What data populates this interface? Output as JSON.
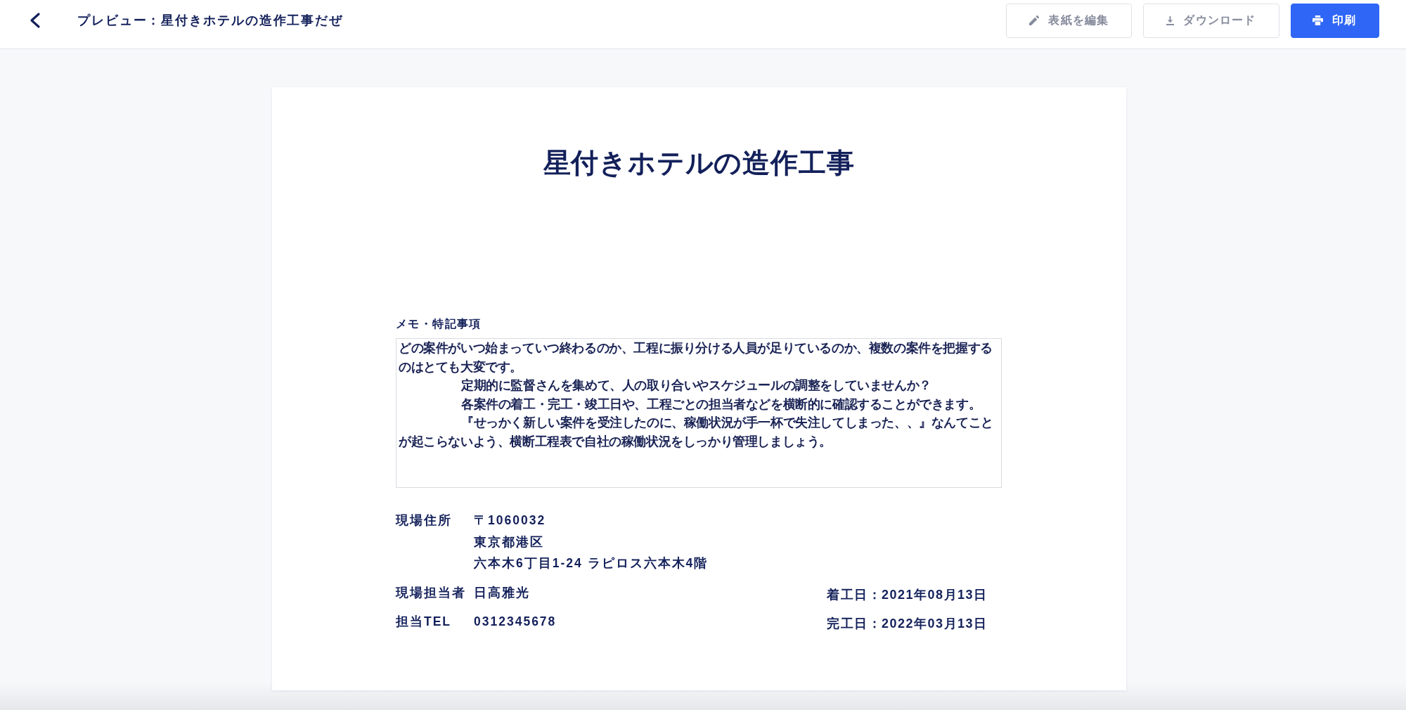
{
  "header": {
    "title": "プレビュー：星付きホテルの造作工事だぜ",
    "actions": [
      {
        "kind": "edit",
        "label": "表紙を編集",
        "primary": false
      },
      {
        "kind": "download",
        "label": "ダウンロード",
        "primary": false
      },
      {
        "kind": "print",
        "label": "印刷",
        "primary": true
      }
    ]
  },
  "document": {
    "title": "星付きホテルの造作工事",
    "memo": {
      "label": "メモ・特記事項",
      "paragraphs": [
        {
          "text": "どの案件がいつ始まっていつ終わるのか、工程に振り分ける人員が足りているのか、複数の案件を把握するのはとても大変です。",
          "indent": false
        },
        {
          "text": "定期的に監督さんを集めて、人の取り合いやスケジュールの調整をしていませんか？",
          "indent": true
        },
        {
          "text": "各案件の着工・完工・竣工日や、工程ごとの担当者などを横断的に確認することができます。",
          "indent": true
        },
        {
          "text": "『せっかく新しい案件を受注したのに、稼働状況が手一杯で失注してしまった、、』なんてことが起こらないよう、横断工程表で自社の稼働状況をしっかり管理しましょう。",
          "indent": true
        }
      ]
    },
    "site_address": {
      "label": "現場住所",
      "lines": [
        "〒1060032",
        "東京都港区",
        "六本木6丁目1-24 ラピロス六本木4階"
      ]
    },
    "site_manager": {
      "label": "現場担当者",
      "value": "日高雅光"
    },
    "phone": {
      "label": "担当TEL",
      "value": "0312345678"
    },
    "dates": [
      "着工日：2021年08月13日",
      "完工日：2022年03月13日"
    ]
  }
}
